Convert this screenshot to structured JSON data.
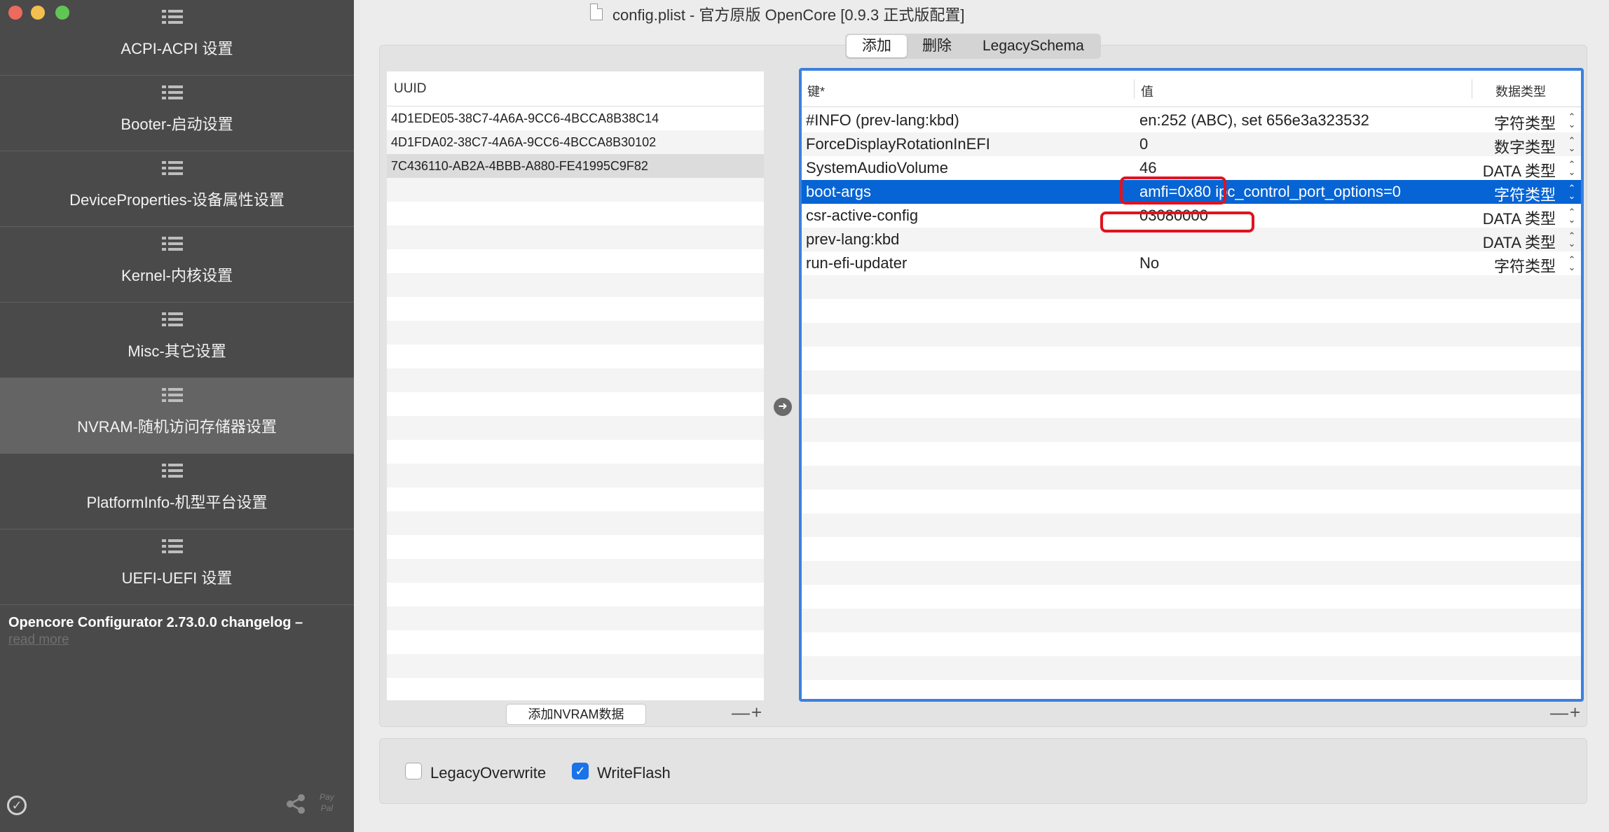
{
  "window": {
    "title": "config.plist - 官方原版 OpenCore [0.9.3 正式版配置]"
  },
  "sidebar": {
    "items": [
      {
        "label": "ACPI-ACPI 设置"
      },
      {
        "label": "Booter-启动设置"
      },
      {
        "label": "DeviceProperties-设备属性设置"
      },
      {
        "label": "Kernel-内核设置"
      },
      {
        "label": "Misc-其它设置"
      },
      {
        "label": "NVRAM-随机访问存储器设置"
      },
      {
        "label": "PlatformInfo-机型平台设置"
      },
      {
        "label": "UEFI-UEFI 设置"
      }
    ],
    "active_index": 5,
    "changelog": "Opencore Configurator 2.73.0.0 changelog –",
    "read_more": "read more",
    "paypal_line1": "Pay",
    "paypal_line2": "Pal"
  },
  "tabs": [
    {
      "label": "添加",
      "selected": true
    },
    {
      "label": "删除",
      "selected": false
    },
    {
      "label": "LegacySchema",
      "selected": false
    }
  ],
  "uuid_list": {
    "header": "UUID",
    "rows": [
      "4D1EDE05-38C7-4A6A-9CC6-4BCCA8B38C14",
      "4D1FDA02-38C7-4A6A-9CC6-4BCCA8B30102",
      "7C436110-AB2A-4BBB-A880-FE41995C9F82"
    ],
    "selected_index": 2,
    "add_button": "添加NVRAM数据",
    "minus": "—",
    "plus": "+"
  },
  "kv_table": {
    "headers": {
      "key": "键*",
      "value": "值",
      "type": "数据类型"
    },
    "rows": [
      {
        "key": "#INFO (prev-lang:kbd)",
        "value": "en:252 (ABC), set 656e3a323532",
        "type": "字符类型"
      },
      {
        "key": "ForceDisplayRotationInEFI",
        "value": "0",
        "type": "数字类型"
      },
      {
        "key": "SystemAudioVolume",
        "value": "46",
        "type": "DATA 类型"
      },
      {
        "key": "boot-args",
        "value": "amfi=0x80 ipc_control_port_options=0",
        "type": "字符类型"
      },
      {
        "key": "csr-active-config",
        "value": "03080000",
        "type": "DATA 类型"
      },
      {
        "key": "prev-lang:kbd",
        "value": "",
        "type": "DATA 类型"
      },
      {
        "key": "run-efi-updater",
        "value": "No",
        "type": "字符类型"
      }
    ],
    "selected_index": 3,
    "minus": "—",
    "plus": "+"
  },
  "options": {
    "legacy_overwrite": {
      "label": "LegacyOverwrite",
      "checked": false
    },
    "write_flash": {
      "label": "WriteFlash",
      "checked": true
    }
  },
  "colors": {
    "accent": "#0764d4",
    "highlight_box": "#e0131f",
    "sidebar_bg": "#4a4a4a"
  }
}
